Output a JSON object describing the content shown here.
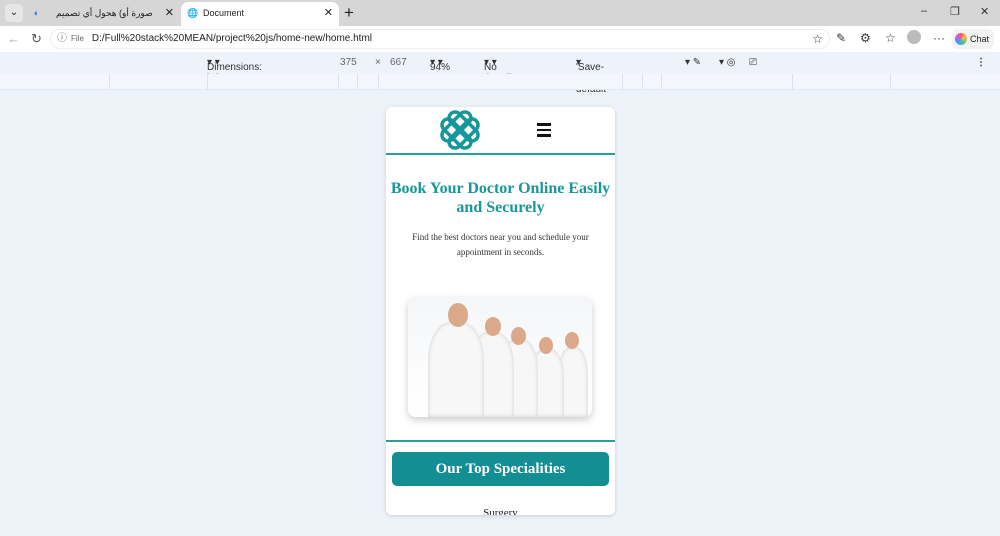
{
  "browser": {
    "tabs": [
      {
        "label": "هحول أي تصميم (صورة أو Figma) إ",
        "icon": "app-icon"
      },
      {
        "label": "Document",
        "icon": "globe-icon"
      }
    ],
    "url_prefix": "File",
    "url": "D:/Full%20stack%20MEAN/project%20js/home-new/home.html",
    "chat_label": "Chat"
  },
  "devtools": {
    "dimensions": "Dimensions: iPhone SE",
    "width": "375",
    "x": "×",
    "height": "667",
    "zoom": "94%",
    "throttling": "No throttling",
    "save_data": "'Save-Data': default"
  },
  "page": {
    "title": "Book Your Doctor Online Easily and Securely",
    "subtitle": "Find the best doctors near you and schedule your appointment in seconds.",
    "specialities_button": "Our Top Specialities",
    "first_speciality": "Surgery",
    "accent": "#138e93"
  }
}
